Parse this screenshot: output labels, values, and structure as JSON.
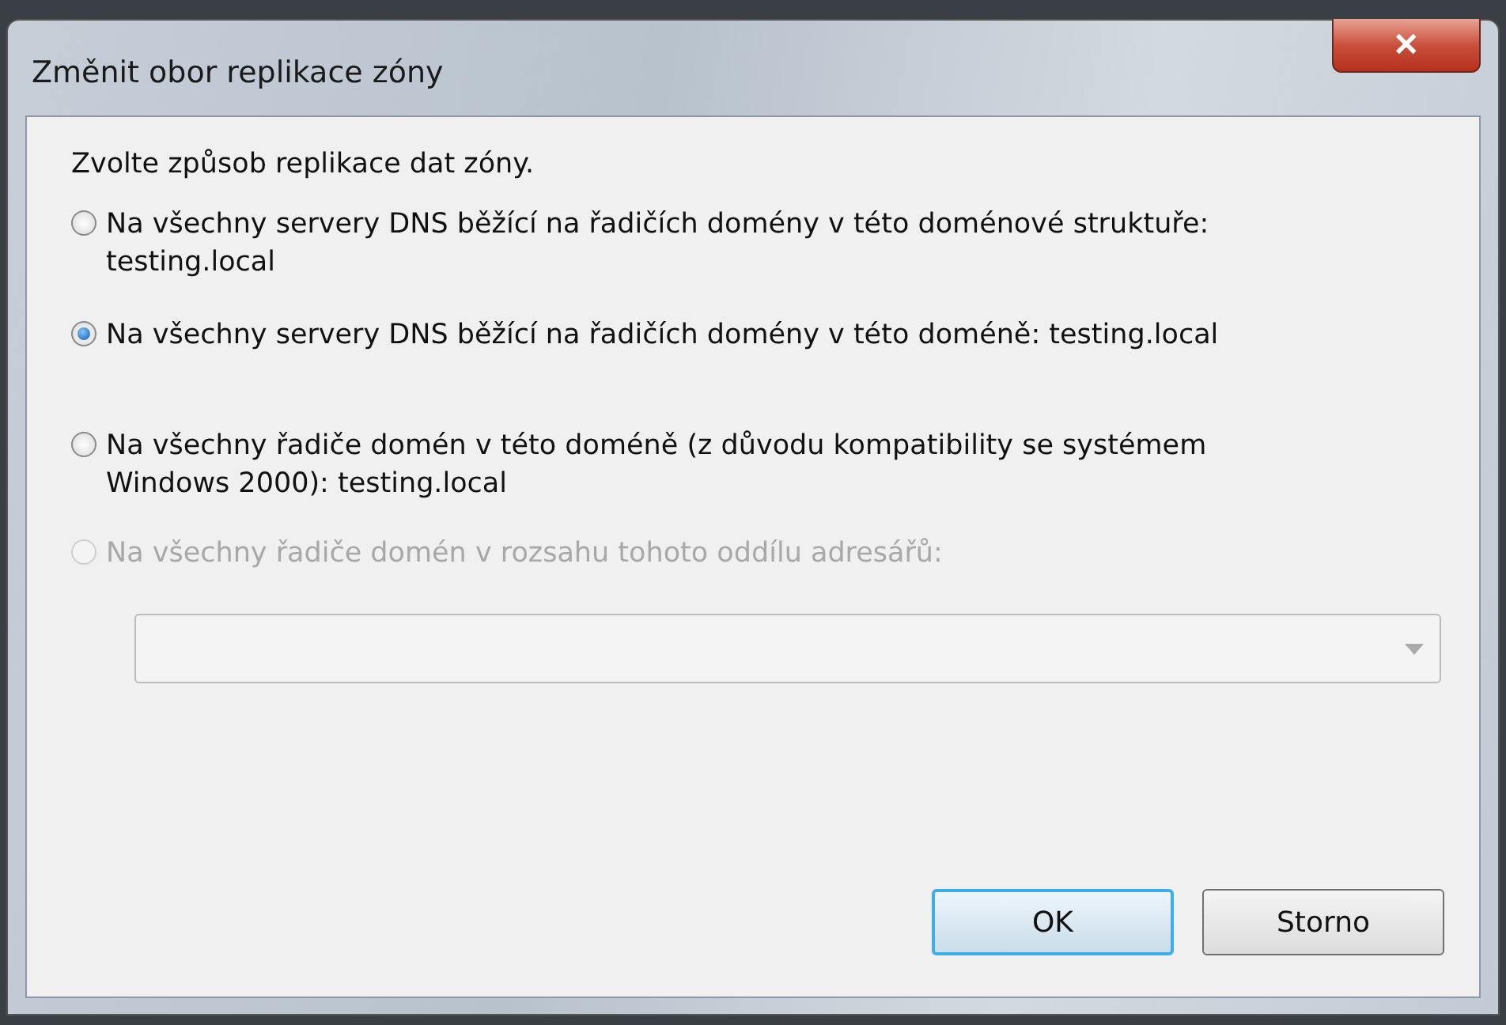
{
  "window": {
    "title": "Změnit obor replikace zóny",
    "close_label": "✕"
  },
  "prompt": "Zvolte způsob replikace dat zóny.",
  "options": [
    {
      "label": "Na všechny servery DNS běžící na řadičích domény v této doménové struktuře: testing.local",
      "selected": false,
      "disabled": false
    },
    {
      "label": "Na všechny servery DNS běžící na řadičích domény v této doméně: testing.local",
      "selected": true,
      "disabled": false
    },
    {
      "label": "Na všechny řadiče domén v této doméně (z důvodu kompatibility se systémem Windows 2000): testing.local",
      "selected": false,
      "disabled": false
    },
    {
      "label": "Na všechny řadiče domén v rozsahu tohoto oddílu adresářů:",
      "selected": false,
      "disabled": true
    }
  ],
  "dropdown": {
    "disabled": true
  },
  "buttons": [
    {
      "label": "OK",
      "default": true
    },
    {
      "label": "Storno",
      "default": false
    }
  ]
}
